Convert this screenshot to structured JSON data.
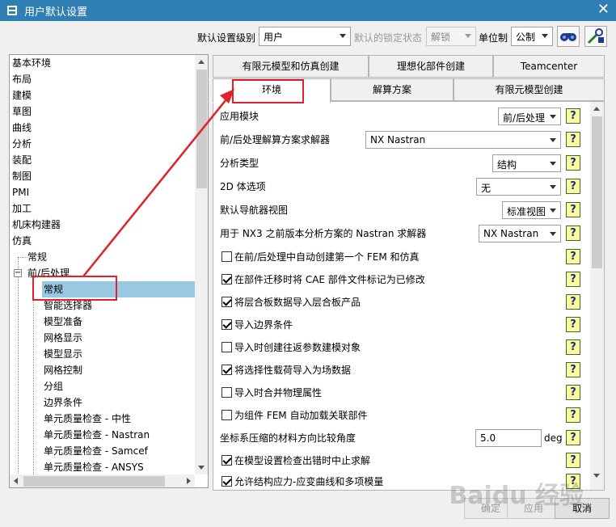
{
  "window": {
    "title": "用户默认设置",
    "accent": "#2f7fb2"
  },
  "toolbar": {
    "level_label": "默认设置级别",
    "level_value": "用户",
    "lock_label": "默认的锁定状态",
    "lock_value": "解锁",
    "unit_label": "单位制",
    "unit_value": "公制"
  },
  "tree": {
    "items": [
      "基本环境",
      "布局",
      "建模",
      "草图",
      "曲线",
      "分析",
      "装配",
      "制图",
      "PMI",
      "加工",
      "机床构建器",
      "仿真",
      "常规",
      "前/后处理",
      "常规",
      "智能选择器",
      "模型准备",
      "网格显示",
      "模型显示",
      "网格控制",
      "分组",
      "边界条件",
      "单元质量检查 - 中性",
      "单元质量检查 - Nastran",
      "单元质量检查 - Samcef",
      "单元质量检查 - ANSYS"
    ],
    "expander": "−"
  },
  "tabs": {
    "row1": [
      "有限元模型和仿真创建",
      "理想化部件创建",
      "Teamcenter"
    ],
    "row2": [
      "环境",
      "解算方案",
      "有限元模型创建"
    ]
  },
  "panel": {
    "app_module_label": "应用模块",
    "app_module_value": "前/后处理",
    "solver_label": "前/后处理解算方案求解器",
    "solver_value": "NX Nastran",
    "analysis_label": "分析类型",
    "analysis_value": "结构",
    "opt2d_label": "2D 体选项",
    "opt2d_value": "无",
    "nav_label": "默认导航器视图",
    "nav_value": "标准视图",
    "nx3_label": "用于 NX3 之前版本分析方案的 Nastran 求解器",
    "nx3_value": "NX Nastran",
    "checks": [
      {
        "label": "在前/后处理中自动创建第一个 FEM 和仿真",
        "checked": false
      },
      {
        "label": "在部件迁移时将 CAE 部件文件标记为已修改",
        "checked": true
      },
      {
        "label": "将层合板数据导入层合板产品",
        "checked": true
      },
      {
        "label": "导入边界条件",
        "checked": true
      },
      {
        "label": "导入时创建往返参数建模对象",
        "checked": false
      },
      {
        "label": "将选择性载荷导入为场数据",
        "checked": true
      },
      {
        "label": "导入时合并物理属性",
        "checked": false
      },
      {
        "label": "为组件 FEM 自动加载关联部件",
        "checked": false
      }
    ],
    "ratio_label": "坐标系压缩的材料方向比较角度",
    "ratio_value": "5.0",
    "ratio_unit": "deg",
    "stop_label": "在模型设置检查出错时中止求解",
    "cut_label": "允许结构应力-应变曲线和多项模量",
    "help_glyph": "?"
  },
  "buttons": {
    "ok": "确定",
    "apply": "应用",
    "cancel": "取消"
  },
  "watermark": "Baidu 经验"
}
